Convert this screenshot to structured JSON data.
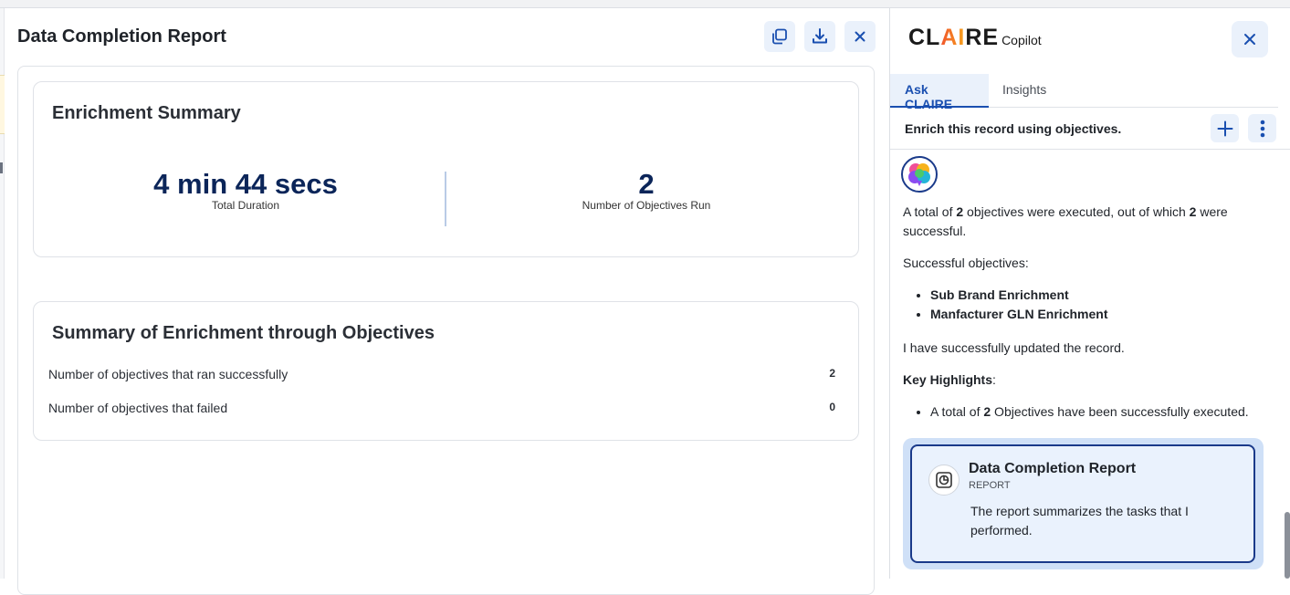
{
  "report": {
    "title": "Data Completion Report",
    "summary_card": {
      "title": "Enrichment Summary",
      "duration_value": "4 min 44 secs",
      "duration_label": "Total Duration",
      "objectives_value": "2",
      "objectives_label": "Number of Objectives Run"
    },
    "objectives_card": {
      "title": "Summary of Enrichment through Objectives",
      "rows": [
        {
          "label": "Number of objectives that ran successfully",
          "value": "2"
        },
        {
          "label": "Number of objectives that failed",
          "value": "0"
        }
      ]
    }
  },
  "copilot": {
    "brand_cl": "CL",
    "brand_ai": "AI",
    "brand_re": "RE",
    "brand_sub": "Copilot",
    "tabs": [
      {
        "label": "Ask CLAIRE",
        "active": true
      },
      {
        "label": "Insights",
        "active": false
      }
    ],
    "prompt": "Enrich this record using objectives.",
    "message": {
      "intro_1": "A total of ",
      "intro_count1": "2",
      "intro_2": " objectives were executed, out of which ",
      "intro_count2": "2",
      "intro_3": " were successful.",
      "successful_heading": "Successful objectives:",
      "successful_items": [
        "Sub Brand Enrichment",
        "Manfacturer GLN Enrichment"
      ],
      "updated": "I have successfully updated the record.",
      "highlights_heading": "Key Highlights",
      "highlights_colon": ":",
      "highlight_1": "A total of ",
      "highlight_count": "2",
      "highlight_2": " Objectives have been successfully executed."
    },
    "report_card": {
      "title": "Data Completion Report",
      "type": "REPORT",
      "description": "The report summarizes the tasks that I performed."
    }
  },
  "icons": {
    "copy": "copy-icon",
    "download": "download-icon",
    "close": "close-icon",
    "plus": "plus-icon",
    "more": "more-vertical-icon",
    "brain": "brain-avatar-icon",
    "report": "report-chart-icon"
  },
  "colors": {
    "accent": "#1a4fb0",
    "navy": "#0b2559",
    "button_bg": "#eaf1fb",
    "card_highlight": "#cfe0f7"
  }
}
